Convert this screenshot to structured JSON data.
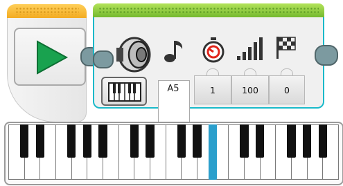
{
  "start_block": {
    "button": "play-icon",
    "accent": "#f2a81c",
    "play_color": "#19a24f"
  },
  "sound_block": {
    "accent": "#6eb52a",
    "border": "#19b9c9",
    "mode_icon": "piano-keys-icon",
    "parameters": [
      {
        "icon": "music-note-icon",
        "value": "A5"
      },
      {
        "icon": "timer-icon",
        "value": "1"
      },
      {
        "icon": "volume-icon",
        "value": "100"
      },
      {
        "icon": "checkered-flag-icon",
        "value": "0"
      }
    ]
  },
  "keyboard": {
    "white_keys": 21,
    "selected_key_color": "#2b9fcc",
    "selected_note": "A5"
  }
}
